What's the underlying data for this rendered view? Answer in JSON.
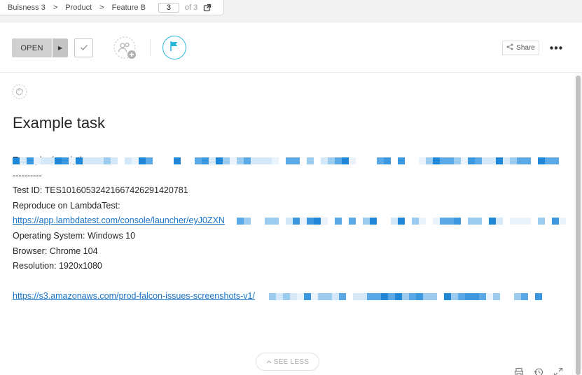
{
  "breadcrumb": {
    "items": [
      "Buisness 3",
      "Product",
      "Feature B"
    ],
    "separator": ">",
    "page_current": "3",
    "page_of": "of 3"
  },
  "toolbar": {
    "status_label": "OPEN",
    "share_label": "Share",
    "accent_color": "#27b7dc"
  },
  "task": {
    "title": "Example task",
    "description": {
      "line1": "Example description",
      "line2": "----------",
      "line3": "Test ID: TES1016053242166742629142078 1",
      "line4": "Reproduce on LambdaTest:",
      "link1": "https://app.lambdatest.com/console/launcher/eyJ0ZXN",
      "os": "Operating System: Windows 10",
      "browser": "Browser: Chrome 104",
      "resolution": "Resolution: 1920x1080",
      "link2": "https://s3.amazonaws.com/prod-falcon-issues-screenshots-v1/"
    }
  },
  "see_less_label": "SEE LESS",
  "icons": [
    "external-link-icon",
    "dropdown-arrow-icon",
    "check-icon",
    "add-assignee-icon",
    "flag-icon",
    "share-icon",
    "more-icon",
    "tag-icon",
    "chevron-up-icon",
    "print-icon",
    "history-icon",
    "expand-icon"
  ]
}
